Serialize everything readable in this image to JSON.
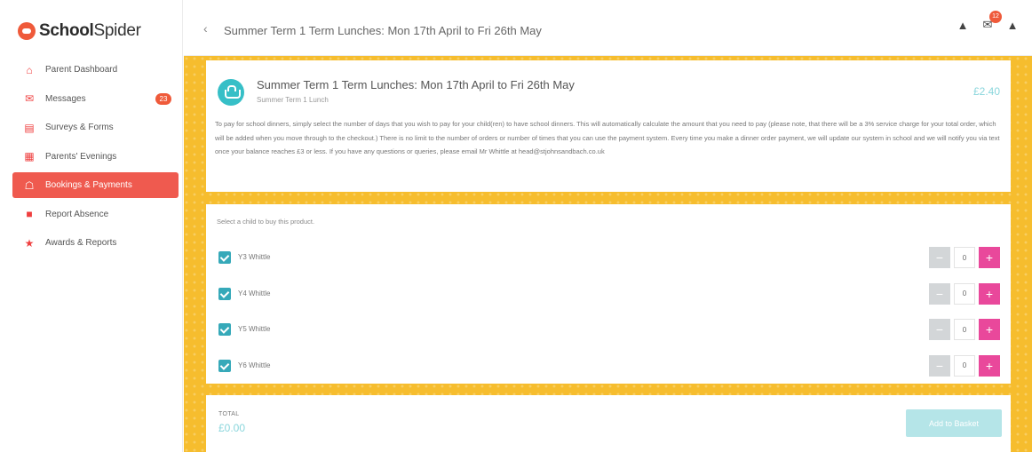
{
  "brand": {
    "name_bold": "School",
    "name_rest": "Spider"
  },
  "sidebar": {
    "items": [
      {
        "label": "Parent Dashboard",
        "icon": "home-icon",
        "glyph": "⌂"
      },
      {
        "label": "Messages",
        "icon": "envelope-icon",
        "glyph": "✉",
        "badge": "23"
      },
      {
        "label": "Surveys & Forms",
        "icon": "document-icon",
        "glyph": "▤"
      },
      {
        "label": "Parents' Evenings",
        "icon": "calendar-icon",
        "glyph": "▦"
      },
      {
        "label": "Bookings & Payments",
        "icon": "bank-icon",
        "glyph": "☖",
        "active": true
      },
      {
        "label": "Report Absence",
        "icon": "briefcase-icon",
        "glyph": "■"
      },
      {
        "label": "Awards & Reports",
        "icon": "trophy-icon",
        "glyph": "★"
      }
    ]
  },
  "topbar": {
    "back_glyph": "‹",
    "title": "Summer Term 1 Term Lunches: Mon 17th April to Fri 26th May",
    "icons": [
      {
        "name": "lock-icon",
        "glyph": "▲"
      },
      {
        "name": "messages-icon",
        "glyph": "✉",
        "badge": "12"
      },
      {
        "name": "bell-icon",
        "glyph": "▲"
      }
    ]
  },
  "product": {
    "title": "Summer Term 1 Term Lunches: Mon 17th April to Fri 26th May",
    "subtitle": "Summer Term 1 Lunch",
    "price": "£2.40",
    "description": "To pay for school dinners, simply select the number of days that you wish to pay for your child(ren) to have school dinners. This will automatically calculate the amount that you need to pay (please note, that there will be a 3% service charge for your total order, which will be added when you move through to the checkout.) There is no limit to the number of orders or number of times that you can use the payment system. Every time you make a dinner order payment, we will update our system in school and we will notify you via text once your balance reaches £3 or less. If you have any questions or queries, please email Mr Whittle at head@stjohnsandbach.co.uk"
  },
  "children": {
    "label": "Select a child to buy this product.",
    "list": [
      {
        "name": "Y3 Whittle",
        "checked": true,
        "qty": "0"
      },
      {
        "name": "Y4 Whittle",
        "checked": true,
        "qty": "0"
      },
      {
        "name": "Y5 Whittle",
        "checked": true,
        "qty": "0"
      },
      {
        "name": "Y6 Whittle",
        "checked": true,
        "qty": "0"
      }
    ],
    "minus_glyph": "−",
    "plus_glyph": "+"
  },
  "footer": {
    "total_label": "TOTAL",
    "total_value": "£0.00",
    "add_button": "Add to Basket"
  },
  "colors": {
    "accent_red": "#ef5a4f",
    "teal": "#36bfc7",
    "pink": "#e9489b",
    "yellow_bg": "#f6bd2e"
  }
}
